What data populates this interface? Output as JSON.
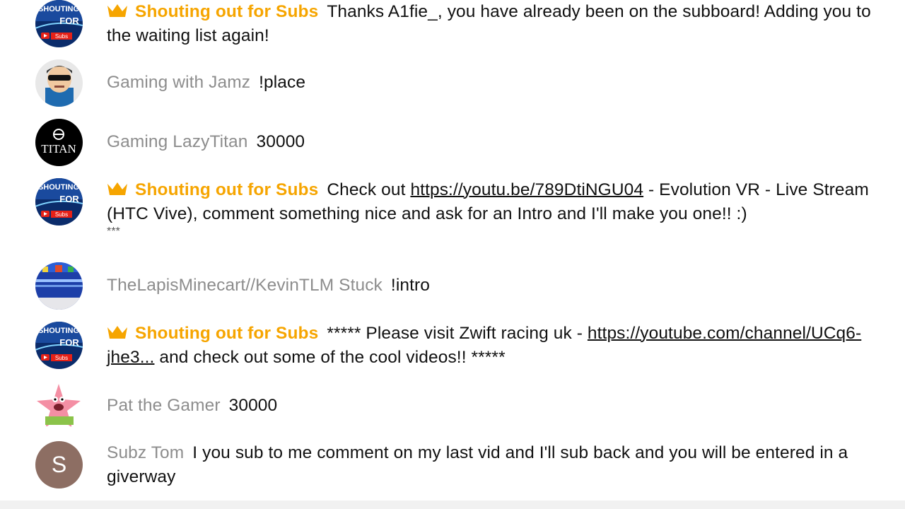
{
  "chat": {
    "messages": [
      {
        "author": "Shouting out for Subs",
        "is_moderator": true,
        "avatar": "shouting-out-for-subs-avatar",
        "parts": [
          {
            "text": "Thanks A1fie_, you have already been on the subboard! Adding you to the waiting list again!"
          }
        ]
      },
      {
        "author": "Gaming with Jamz",
        "is_moderator": false,
        "avatar": "jamz-avatar",
        "parts": [
          {
            "text": "!place"
          }
        ]
      },
      {
        "author": "Gaming LazyTitan",
        "is_moderator": false,
        "avatar": "titan-avatar",
        "avatar_text": "TITAN",
        "parts": [
          {
            "text": "30000"
          }
        ]
      },
      {
        "author": "Shouting out for Subs",
        "is_moderator": true,
        "avatar": "shouting-out-for-subs-avatar",
        "parts": [
          {
            "text": "Check out "
          },
          {
            "link": "https://youtu.be/789DtiNGU04"
          },
          {
            "text": " - Evolution VR - Live Stream (HTC Vive), comment something nice and ask for an Intro and I'll make you one!! :)"
          }
        ],
        "trailing": "***"
      },
      {
        "author": "TheLapisMinecart//KevinTLM Stuck",
        "is_moderator": false,
        "avatar": "lapis-minecart-avatar",
        "parts": [
          {
            "text": "!intro"
          }
        ]
      },
      {
        "author": "Shouting out for Subs",
        "is_moderator": true,
        "avatar": "shouting-out-for-subs-avatar",
        "parts": [
          {
            "text": "***** Please visit Zwift racing uk - "
          },
          {
            "link": "https://youtube.com/channel/UCq6-jhe3..."
          },
          {
            "text": " and check out some of the cool videos!! *****"
          }
        ]
      },
      {
        "author": "Pat the Gamer",
        "is_moderator": false,
        "avatar": "patrick-star-avatar",
        "parts": [
          {
            "text": "30000"
          }
        ]
      },
      {
        "author": "Subz Tom",
        "is_moderator": false,
        "avatar": "letter-s-avatar",
        "avatar_text": "S",
        "parts": [
          {
            "text": "I you sub to me comment on my last vid and I'll sub back and you will be entered in a giverway"
          }
        ]
      }
    ],
    "avatar_logo_text": [
      "SHOUTING",
      "FOR",
      "Subs"
    ]
  },
  "colors": {
    "moderator_name": "#f6a500",
    "author_name": "#8d8d8d",
    "message_text": "#111111",
    "letter_avatar_bg": "#8d6e63"
  }
}
